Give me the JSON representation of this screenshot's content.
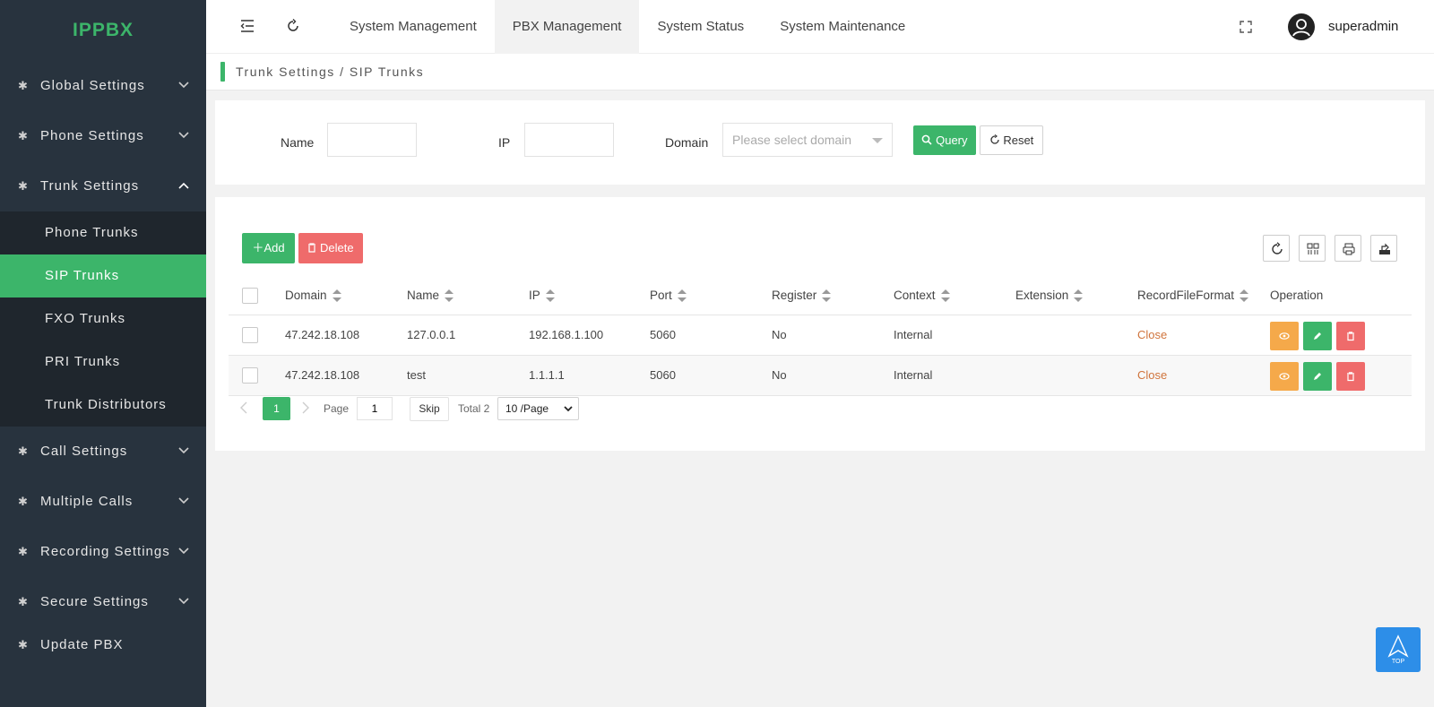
{
  "app": {
    "logo": "IPPBX"
  },
  "sidebar": {
    "menus": [
      {
        "label": "Global Settings"
      },
      {
        "label": "Phone Settings"
      },
      {
        "label": "Trunk Settings"
      },
      {
        "label": "Call Settings"
      },
      {
        "label": "Multiple Calls"
      },
      {
        "label": "Recording Settings"
      },
      {
        "label": "Secure Settings"
      },
      {
        "label": "Update PBX"
      }
    ],
    "trunk_submenu": [
      {
        "label": "Phone Trunks"
      },
      {
        "label": "SIP Trunks"
      },
      {
        "label": "FXO Trunks"
      },
      {
        "label": "PRI Trunks"
      },
      {
        "label": "Trunk Distributors"
      }
    ]
  },
  "header": {
    "tabs": [
      {
        "label": "System Management"
      },
      {
        "label": "PBX Management"
      },
      {
        "label": "System Status"
      },
      {
        "label": "System Maintenance"
      }
    ],
    "active_tab": "PBX Management",
    "username": "superadmin"
  },
  "breadcrumb": "Trunk Settings / SIP Trunks",
  "search": {
    "name_label": "Name",
    "ip_label": "IP",
    "domain_label": "Domain",
    "domain_placeholder": "Please select domain",
    "query_label": "Query",
    "reset_label": "Reset"
  },
  "toolbar": {
    "add_label": "Add",
    "delete_label": "Delete"
  },
  "table": {
    "columns": [
      "Domain",
      "Name",
      "IP",
      "Port",
      "Register",
      "Context",
      "Extension",
      "RecordFileFormat",
      "Operation"
    ],
    "rows": [
      {
        "domain": "47.242.18.108",
        "name": "127.0.0.1",
        "ip": "192.168.1.100",
        "port": "5060",
        "register": "No",
        "context": "Internal",
        "extension": "",
        "record": "Close"
      },
      {
        "domain": "47.242.18.108",
        "name": "test",
        "ip": "1.1.1.1",
        "port": "5060",
        "register": "No",
        "context": "Internal",
        "extension": "",
        "record": "Close"
      }
    ]
  },
  "pagination": {
    "current_page": "1",
    "page_label": "Page",
    "page_input": "1",
    "skip_label": "Skip",
    "total_label": "Total 2",
    "page_size": "10 /Page"
  },
  "colors": {
    "accent": "#3cb56a",
    "sidebar_bg": "#28333e",
    "danger": "#ef6b6b",
    "warning": "#f5a94a",
    "link": "#d0743c",
    "top_button": "#2d8ee8"
  }
}
